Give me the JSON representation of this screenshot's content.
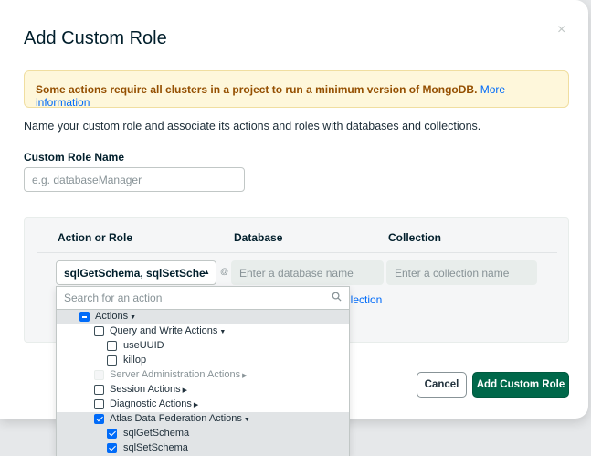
{
  "modal": {
    "title": "Add Custom Role",
    "close": "×",
    "banner_text": "Some actions require all clusters in a project to run a minimum version of MongoDB.",
    "banner_link": "More information",
    "description": "Name your custom role and associate its actions and roles with databases and collections.",
    "role_name_label": "Custom Role Name",
    "role_name_placeholder": "e.g. databaseManager",
    "role_name_value": ""
  },
  "table": {
    "headers": [
      "Action or Role",
      "Database",
      "Collection"
    ],
    "selected_actions": "sqlGetSchema, sqlSetSche",
    "caret": "▲",
    "at_symbol": "@",
    "database_placeholder": "Enter a database name",
    "collection_placeholder": "Enter a collection name",
    "partial_link": "llection"
  },
  "dropdown": {
    "search_placeholder": "Search for an action",
    "items": [
      {
        "label": "Actions",
        "state": "indeterminate",
        "arrow": "▼",
        "highlight": true
      },
      {
        "label": "Query and Write Actions",
        "state": "unchecked",
        "arrow": "▼",
        "highlight": false
      },
      {
        "label": "useUUID",
        "state": "unchecked",
        "arrow": "",
        "highlight": false
      },
      {
        "label": "killop",
        "state": "unchecked",
        "arrow": "",
        "highlight": false
      },
      {
        "label": "Server Administration Actions",
        "state": "disabled",
        "arrow": "▶",
        "highlight": false
      },
      {
        "label": "Session Actions",
        "state": "unchecked",
        "arrow": "▶",
        "highlight": false
      },
      {
        "label": "Diagnostic Actions",
        "state": "unchecked",
        "arrow": "▶",
        "highlight": false
      },
      {
        "label": "Atlas Data Federation Actions",
        "state": "checked",
        "arrow": "▼",
        "highlight": true
      },
      {
        "label": "sqlGetSchema",
        "state": "checked",
        "arrow": "",
        "highlight": true
      },
      {
        "label": "sqlSetSchema",
        "state": "checked",
        "arrow": "",
        "highlight": true
      }
    ]
  },
  "footer": {
    "cancel_label": "Cancel",
    "submit_label": "Add Custom Role"
  },
  "colors": {
    "primary_green": "#00684a",
    "link_blue": "#016bf8",
    "warning_bg": "#fef7db",
    "warning_text": "#944f01"
  }
}
